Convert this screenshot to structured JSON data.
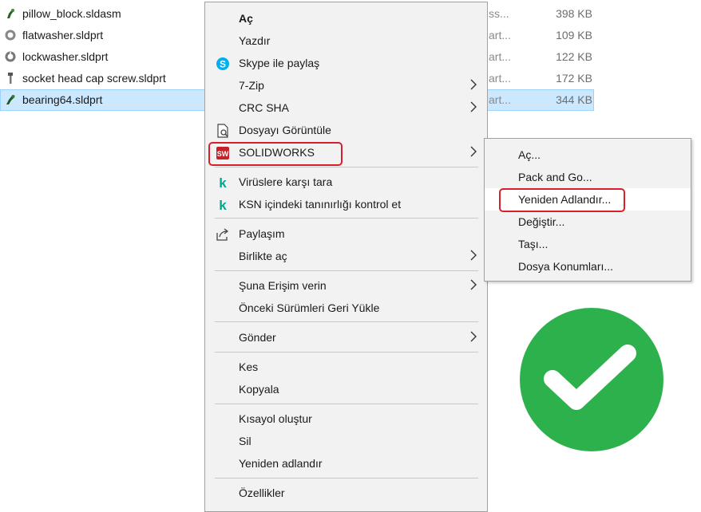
{
  "files": [
    {
      "name": "pillow_block.sldasm",
      "type": "ss...",
      "size": "398 KB",
      "icon": "assembly-icon",
      "selected": false
    },
    {
      "name": "flatwasher.sldprt",
      "type": "art...",
      "size": "109 KB",
      "icon": "washer-icon",
      "selected": false
    },
    {
      "name": "lockwasher.sldprt",
      "type": "art...",
      "size": "122 KB",
      "icon": "washer-icon",
      "selected": false
    },
    {
      "name": "socket head cap screw.sldprt",
      "type": "art...",
      "size": "172 KB",
      "icon": "screw-icon",
      "selected": false
    },
    {
      "name": "bearing64.sldprt",
      "type": "art...",
      "size": "344 KB",
      "icon": "part-icon",
      "selected": true
    }
  ],
  "context_menu": {
    "open": "Aç",
    "print": "Yazdır",
    "skype_share": "Skype ile paylaş",
    "zip": "7-Zip",
    "crc": "CRC SHA",
    "view_file": "Dosyayı Görüntüle",
    "solidworks": "SOLIDWORKS",
    "scan_virus": "Virüslere karşı tara",
    "ksn_check": "KSN içindeki tanınırlığı kontrol et",
    "share": "Paylaşım",
    "open_with": "Birlikte aç",
    "give_access": "Şuna Erişim verin",
    "restore_versions": "Önceki Sürümleri Geri Yükle",
    "send_to": "Gönder",
    "cut": "Kes",
    "copy": "Kopyala",
    "create_shortcut": "Kısayol oluştur",
    "delete": "Sil",
    "rename": "Yeniden adlandır",
    "properties": "Özellikler"
  },
  "solidworks_submenu": {
    "open": "Aç...",
    "pack_and_go": "Pack and Go...",
    "rename": "Yeniden Adlandır...",
    "replace": "Değiştir...",
    "move": "Taşı...",
    "file_locations": "Dosya Konumları..."
  },
  "colors": {
    "highlight_red": "#d9202a",
    "check_green": "#2db14d",
    "selection_blue": "#cce8ff",
    "menu_bg": "#f2f2f2",
    "kaspersky_teal": "#00a88e",
    "skype_blue": "#00aff0"
  }
}
